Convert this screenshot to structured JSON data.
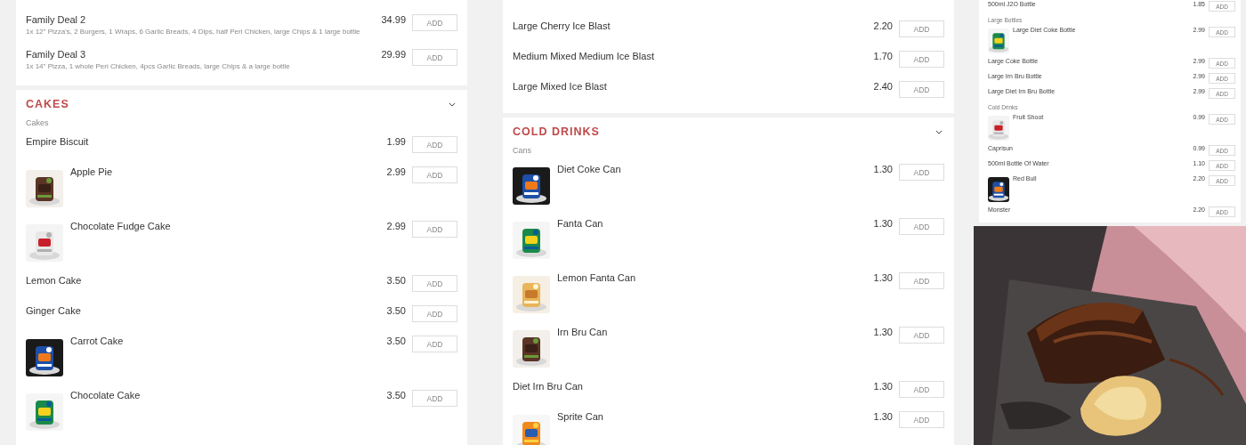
{
  "columns": [
    {
      "kind": "full",
      "cards": [
        {
          "groups": [
            {
              "items": [
                {
                  "kind": "plain",
                  "name": "Family Deal 2",
                  "description": "1x 12\" Pizza's, 2 Burgers, 1 Wraps, 6 Garlic Breads, 4 Dips, half Peri Chicken, large Chips & 1 large bottle",
                  "price": "34.99",
                  "button": "ADD"
                },
                {
                  "kind": "plain",
                  "name": "Family Deal 3",
                  "description": "1x 14\" Pizza, 1 whole Peri Chicken, 4pcs Garlic Breads, large Chips & a large bottle",
                  "price": "29.99",
                  "button": "ADD"
                }
              ]
            }
          ]
        },
        {
          "title": "CAKES",
          "groups": [
            {
              "subheading": "Cakes",
              "items": [
                {
                  "kind": "plain",
                  "name": "Empire Biscuit",
                  "price": "1.99",
                  "button": "ADD"
                },
                {
                  "kind": "picture",
                  "name": "Apple Pie",
                  "price": "2.99",
                  "button": "ADD"
                },
                {
                  "kind": "picture",
                  "name": "Chocolate Fudge Cake",
                  "price": "2.99",
                  "button": "ADD"
                },
                {
                  "kind": "plain",
                  "name": "Lemon Cake",
                  "price": "3.50",
                  "button": "ADD"
                },
                {
                  "kind": "plain",
                  "name": "Ginger Cake",
                  "price": "3.50",
                  "button": "ADD"
                },
                {
                  "kind": "picture",
                  "name": "Carrot Cake",
                  "price": "3.50",
                  "button": "ADD"
                },
                {
                  "kind": "picture",
                  "name": "Chocolate Cake",
                  "price": "3.50",
                  "button": "ADD"
                }
              ]
            }
          ]
        }
      ]
    },
    {
      "kind": "full",
      "cards": [
        {
          "groups": [
            {
              "items": [
                {
                  "kind": "plain",
                  "name": "Large Cherry Ice Blast",
                  "price": "2.20",
                  "button": "ADD"
                },
                {
                  "kind": "plain",
                  "name": "Medium Mixed Medium Ice Blast",
                  "price": "1.70",
                  "button": "ADD"
                },
                {
                  "kind": "plain",
                  "name": "Large Mixed Ice Blast",
                  "price": "2.40",
                  "button": "ADD"
                }
              ]
            }
          ]
        },
        {
          "title": "COLD DRINKS",
          "groups": [
            {
              "subheading": "Cans",
              "items": [
                {
                  "kind": "picture",
                  "name": "Diet Coke Can",
                  "price": "1.30",
                  "button": "ADD"
                },
                {
                  "kind": "picture",
                  "name": "Fanta Can",
                  "price": "1.30",
                  "button": "ADD"
                },
                {
                  "kind": "picture",
                  "name": "Lemon Fanta Can",
                  "price": "1.30",
                  "button": "ADD"
                },
                {
                  "kind": "picture",
                  "name": "Irn Bru Can",
                  "price": "1.30",
                  "button": "ADD"
                },
                {
                  "kind": "plain",
                  "name": "Diet Irn Bru Can",
                  "price": "1.30",
                  "button": "ADD"
                },
                {
                  "kind": "picture",
                  "name": "Sprite Can",
                  "price": "1.30",
                  "button": "ADD"
                }
              ]
            }
          ]
        }
      ]
    },
    {
      "kind": "mini",
      "cards": [
        {
          "groups": [
            {
              "items": [
                {
                  "kind": "plain",
                  "name": "500ml J2O Bottle",
                  "price": "1.85",
                  "button": "ADD"
                }
              ]
            },
            {
              "subheading": "Large Bottles",
              "items": [
                {
                  "kind": "picture",
                  "name": "Large Diet Coke Bottle",
                  "price": "2.99",
                  "button": "ADD"
                },
                {
                  "kind": "plain",
                  "name": "Large Coke Bottle",
                  "price": "2.99",
                  "button": "ADD"
                },
                {
                  "kind": "plain",
                  "name": "Large Irn Bru Bottle",
                  "price": "2.99",
                  "button": "ADD"
                },
                {
                  "kind": "plain",
                  "name": "Large Diet Irn Bru Bottle",
                  "price": "2.99",
                  "button": "ADD"
                }
              ]
            },
            {
              "subheading": "Cold Drinks",
              "items": [
                {
                  "kind": "picture",
                  "name": "Fruit Shoot",
                  "price": "0.99",
                  "button": "ADD"
                },
                {
                  "kind": "plain",
                  "name": "Caprisun",
                  "price": "0.99",
                  "button": "ADD"
                },
                {
                  "kind": "plain",
                  "name": "500ml Bottle Of Water",
                  "price": "1.10",
                  "button": "ADD"
                },
                {
                  "kind": "picture",
                  "name": "Red Bull",
                  "price": "2.20",
                  "button": "ADD"
                },
                {
                  "kind": "plain",
                  "name": "Monster",
                  "price": "2.20",
                  "button": "ADD"
                }
              ]
            }
          ]
        }
      ],
      "photo": {
        "kind": "picture"
      }
    }
  ]
}
